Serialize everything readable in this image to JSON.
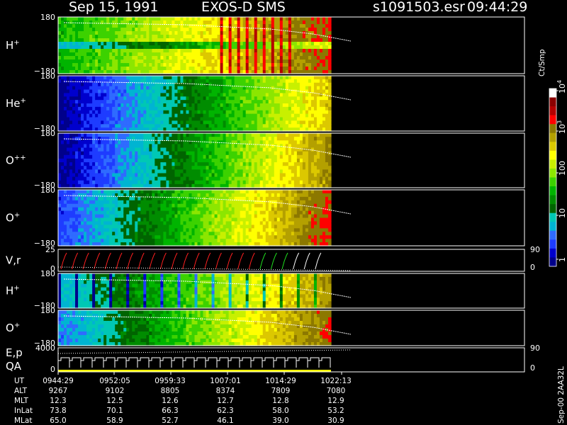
{
  "header": {
    "date": "Sep 15, 1991",
    "instrument": "EXOS-D SMS",
    "file": "s1091503.esr",
    "time": "09:44:29"
  },
  "chart_data": [
    {
      "type": "heatmap",
      "id": "spectrogram-stack",
      "panels": [
        {
          "label": "H",
          "sup": "+",
          "ytop": "180",
          "ybot": "−180"
        },
        {
          "label": "He",
          "sup": "+",
          "ytop": "180",
          "ybot": "−180"
        },
        {
          "label": "O",
          "sup": "++",
          "ytop": "180",
          "ybot": "−180"
        },
        {
          "label": "O",
          "sup": "+",
          "ytop": "180",
          "ybot": "−180"
        },
        {
          "label": "V,r",
          "sup": "",
          "ytop": "25",
          "ybot": "0",
          "right_top": "90",
          "right_bot": "0"
        },
        {
          "label": "H",
          "sup": "+",
          "ytop": "180",
          "ybot": "−180"
        },
        {
          "label": "O",
          "sup": "+",
          "ytop": "180",
          "ybot": "−180"
        },
        {
          "label": "E,p",
          "sup": "",
          "label2": "QA",
          "ytop": "4000",
          "ybot": "0",
          "right_top": "90",
          "right_bot": "0"
        }
      ],
      "x_ticks": [
        "0944:29",
        "0952:05",
        "0959:33",
        "1007:01",
        "1014:29",
        "1022:13"
      ]
    },
    {
      "type": "heatmap",
      "id": "colorbar",
      "unit_label": "Ct/Smp",
      "scale": "log",
      "range": [
        1,
        10000
      ],
      "tick_labels": [
        "1",
        "10",
        "100",
        "10",
        "10"
      ],
      "tick_sups": [
        "",
        "",
        "",
        "3",
        "4"
      ],
      "colors": [
        "#00008b",
        "#0000cd",
        "#1e3cff",
        "#2f6bff",
        "#00b4d2",
        "#00c8b4",
        "#006400",
        "#008c00",
        "#00b400",
        "#3cd200",
        "#8ce600",
        "#c8f000",
        "#ffff00",
        "#dcc800",
        "#b4a000",
        "#8c7800",
        "#ff0000",
        "#b40000",
        "#8b0000",
        "#ffffff"
      ]
    }
  ],
  "side_note": "Sep-00 2AA32L",
  "orbit_info": {
    "rows": [
      {
        "label": "UT",
        "values": [
          "0944:29",
          "0952:05",
          "0959:33",
          "1007:01",
          "1014:29",
          "1022:13"
        ]
      },
      {
        "label": "ALT",
        "values": [
          "9267",
          "9102",
          "8805",
          "8374",
          "7809",
          "7080"
        ]
      },
      {
        "label": "MLT",
        "values": [
          "12.3",
          "12.5",
          "12.6",
          "12.7",
          "12.8",
          "12.9"
        ]
      },
      {
        "label": "InLat",
        "values": [
          "73.8",
          "70.1",
          "66.3",
          "62.3",
          "58.0",
          "53.2"
        ]
      },
      {
        "label": "MLat",
        "values": [
          "65.0",
          "58.9",
          "52.7",
          "46.1",
          "39.0",
          "30.9"
        ]
      }
    ]
  }
}
